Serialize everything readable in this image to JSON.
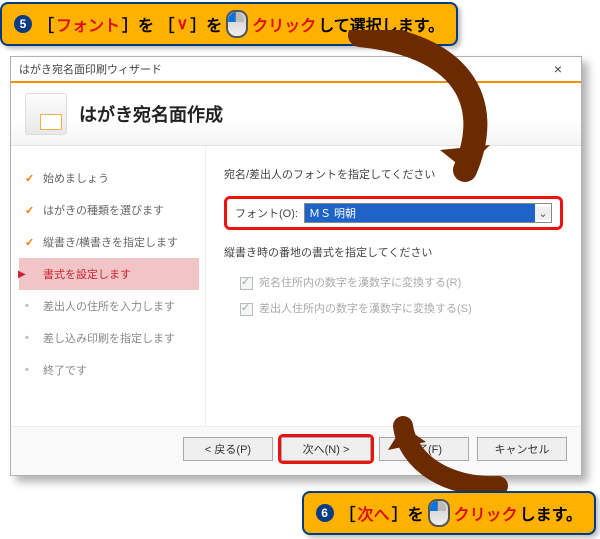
{
  "instruction_top": {
    "num": "5",
    "pre": "［",
    "word1": "フォント",
    "mid1": "］を ［",
    "word2": "∨",
    "mid2": "］を",
    "word3": "クリック",
    "post": "して選択します。"
  },
  "instruction_bottom": {
    "num": "6",
    "pre": "［",
    "word1": "次へ",
    "mid1": "］を",
    "word2": "クリック",
    "post": "します。"
  },
  "window": {
    "title": "はがき宛名面印刷ウィザード",
    "header": "はがき宛名面作成",
    "steps": {
      "s1": "始めましょう",
      "s2": "はがきの種類を選びます",
      "s3": "縦書き/横書きを指定します",
      "s4": "書式を設定します",
      "s5": "差出人の住所を入力します",
      "s6": "差し込み印刷を指定します",
      "s7": "終了です"
    },
    "content": {
      "label1": "宛名/差出人のフォントを指定してください",
      "font_label": "フォント(O):",
      "font_value": "ＭＳ 明朝",
      "label2": "縦書き時の番地の書式を指定してください",
      "opt1": "宛名住所内の数字を漢数字に変換する(R)",
      "opt2": "差出人住所内の数字を漢数字に変換する(S)"
    },
    "buttons": {
      "back": "< 戻る(P)",
      "next": "次へ(N) >",
      "finish": "完了(F)",
      "cancel": "キャンセル"
    }
  }
}
